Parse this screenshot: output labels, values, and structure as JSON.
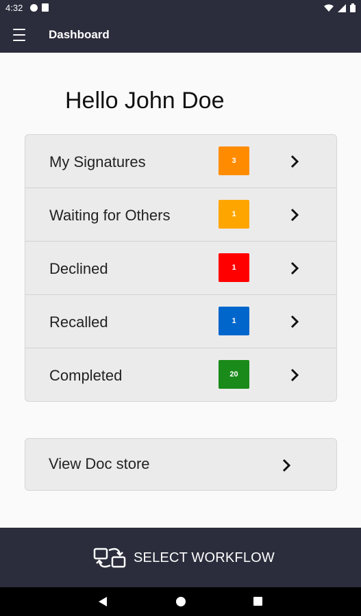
{
  "status_bar": {
    "time": "4:32",
    "left_icons": [
      "privacy-icon",
      "sim-card-icon"
    ],
    "right_icons": [
      "wifi-icon",
      "signal-icon",
      "battery-icon"
    ]
  },
  "app_bar": {
    "title": "Dashboard",
    "menu_icon": "hamburger-menu-icon"
  },
  "greeting": "Hello John Doe",
  "categories": [
    {
      "label": "My Signatures",
      "count": "3",
      "color": "#ff8c00"
    },
    {
      "label": "Waiting for Others",
      "count": "1",
      "color": "#ffa500"
    },
    {
      "label": "Declined",
      "count": "1",
      "color": "#ff0000"
    },
    {
      "label": "Recalled",
      "count": "1",
      "color": "#0066cc"
    },
    {
      "label": "Completed",
      "count": "20",
      "color": "#1a8a1a"
    }
  ],
  "doc_store": {
    "label": "View Doc store"
  },
  "bottom_action": {
    "label": "SELECT WORKFLOW",
    "icon": "workflow-swap-icon"
  },
  "nav_bar": {
    "icons": [
      "back-icon",
      "home-icon",
      "recents-icon"
    ]
  },
  "colors": {
    "app_bar": "#2b2d3c",
    "background": "#fafafa",
    "card": "#ebebeb"
  }
}
